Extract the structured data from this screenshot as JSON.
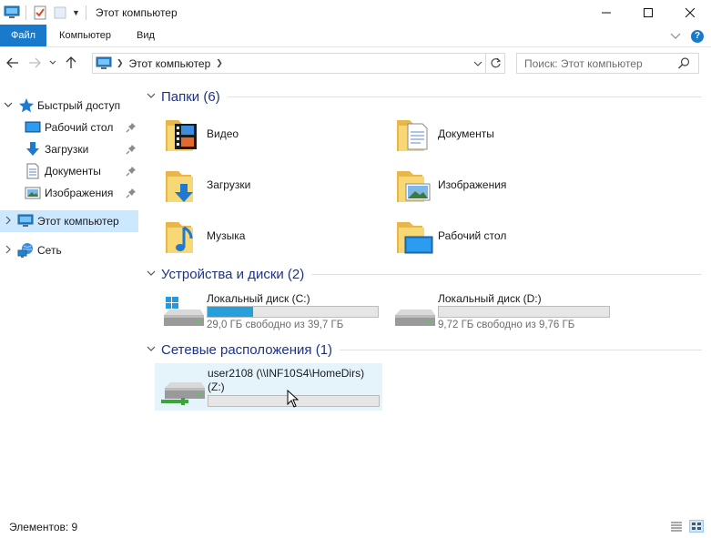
{
  "window": {
    "title": "Этот компьютер",
    "buttons": {
      "minimize": "–",
      "maximize": "☐",
      "close": "✕"
    }
  },
  "ribbon": {
    "tabs": [
      "Файл",
      "Компьютер",
      "Вид"
    ]
  },
  "address": {
    "path": "Этот компьютер"
  },
  "search": {
    "placeholder": "Поиск: Этот компьютер"
  },
  "nav": {
    "quick_access": "Быстрый доступ",
    "quick_items": [
      "Рабочий стол",
      "Загрузки",
      "Документы",
      "Изображения"
    ],
    "this_pc": "Этот компьютер",
    "network": "Сеть"
  },
  "groups": {
    "folders": "Папки (6)",
    "devices": "Устройства и диски (2)",
    "network": "Сетевые расположения (1)"
  },
  "folders": [
    "Видео",
    "Документы",
    "Загрузки",
    "Изображения",
    "Музыка",
    "Рабочий стол"
  ],
  "drives": [
    {
      "name": "Локальный диск (C:)",
      "free": "29,0 ГБ свободно из 39,7 ГБ",
      "used_fraction": 0.27
    },
    {
      "name": "Локальный диск (D:)",
      "free": "9,72 ГБ свободно из 9,76 ГБ",
      "used_fraction": 0.0
    }
  ],
  "network_drive": {
    "name_line1": "user2108 (\\\\INF10S4\\HomeDirs)",
    "name_line2": "(Z:)",
    "used_fraction": 0.0
  },
  "status": {
    "items": "Элементов: 9"
  },
  "colors": {
    "accent": "#1979ca",
    "selection": "#cce8ff",
    "group_title": "#1e3287",
    "bar_fill": "#26a0da"
  }
}
